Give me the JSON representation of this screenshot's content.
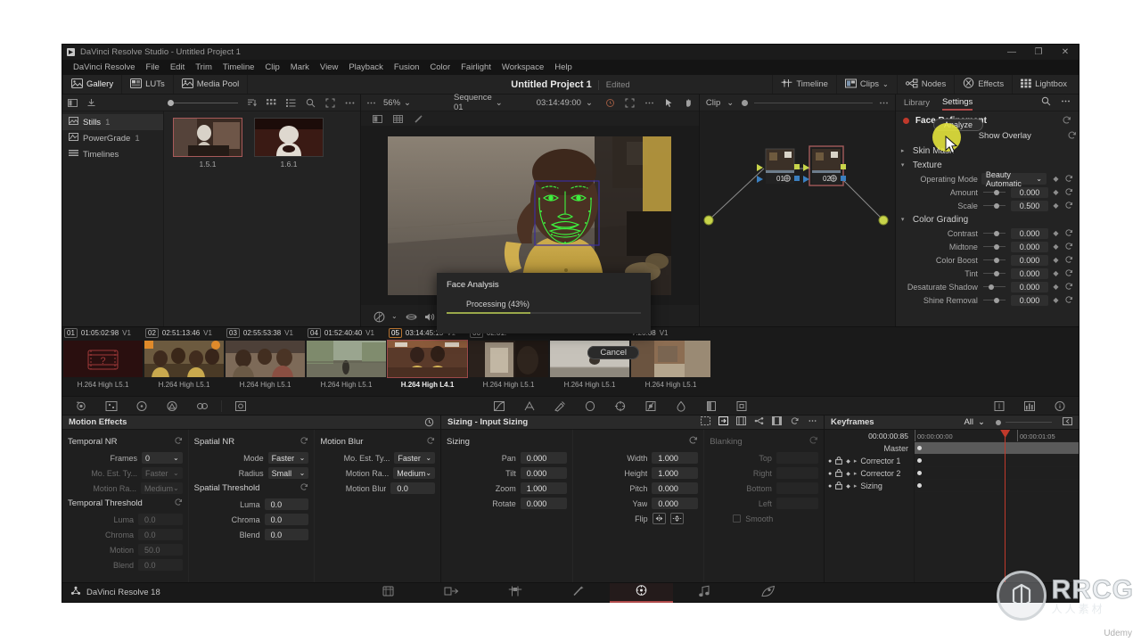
{
  "window": {
    "title": "DaVinci Resolve Studio - Untitled Project 1",
    "minimize": "—",
    "maximize": "❐",
    "close": "✕"
  },
  "menu": [
    "DaVinci Resolve",
    "File",
    "Edit",
    "Trim",
    "Timeline",
    "Clip",
    "Mark",
    "View",
    "Playback",
    "Fusion",
    "Color",
    "Fairlight",
    "Workspace",
    "Help"
  ],
  "toptools": {
    "left_buttons": [
      {
        "label": "Gallery",
        "icon": "gallery-icon"
      },
      {
        "label": "LUTs",
        "icon": "luts-icon"
      },
      {
        "label": "Media Pool",
        "icon": "media-pool-icon"
      }
    ],
    "project_name": "Untitled Project 1",
    "project_state": "Edited",
    "right_buttons": [
      {
        "label": "Timeline",
        "icon": "timeline-icon"
      },
      {
        "label": "Clips",
        "icon": "clips-icon",
        "caret": "⌄"
      },
      {
        "label": "Nodes",
        "icon": "nodes-icon"
      },
      {
        "label": "Effects",
        "icon": "effects-icon"
      },
      {
        "label": "Lightbox",
        "icon": "lightbox-icon"
      }
    ]
  },
  "gallery": {
    "toolbar_icons": [
      "sidebar-toggle-icon",
      "import-still-icon",
      "sort-icon",
      "grid-view-icon",
      "list-view-icon",
      "search-icon",
      "fullscreen-icon",
      "more-options-icon"
    ],
    "tree": [
      {
        "label": "Stills",
        "count": "1",
        "icon": "stills-icon",
        "selected": true
      },
      {
        "label": "PowerGrade",
        "count": "1",
        "icon": "powergrade-icon",
        "selected": false
      },
      {
        "label": "Timelines",
        "count": "",
        "icon": "timelines-icon",
        "selected": false
      }
    ],
    "stills": [
      {
        "caption": "1.5.1",
        "selected": true
      },
      {
        "caption": "1.6.1",
        "selected": false
      }
    ]
  },
  "viewer": {
    "more_icon": "more-options-icon",
    "zoom": "56%",
    "zoom_caret": "⌄",
    "sequence": "Sequence 01",
    "sequence_caret": "⌄",
    "timecode": "03:14:49:00",
    "timecode_caret": "⌄",
    "icons": [
      "loop-icon",
      "fullscreen-icon",
      "more-options-icon",
      "pointer-tool-icon",
      "hand-tool-icon"
    ],
    "tools2": [
      "split-screen-icon",
      "grid-overlay-icon",
      "magic-mask-icon"
    ],
    "clip_label": "Clip",
    "clip_caret": "⌄",
    "bottom_icons": [
      "color-wheel-icon",
      "onion-skin-icon",
      "audio-icon"
    ]
  },
  "nodes": {
    "items": [
      {
        "id": "01",
        "selected": false
      },
      {
        "id": "02",
        "selected": true
      }
    ]
  },
  "modal": {
    "title": "Face Analysis",
    "status": "Processing  (43%)",
    "progress": 43,
    "cancel": "Cancel"
  },
  "tooltip": {
    "label": "Analyze"
  },
  "inspector": {
    "tabs": [
      {
        "label": "Library",
        "active": false
      },
      {
        "label": "Settings",
        "active": true
      }
    ],
    "tab_icons": [
      "search-icon",
      "more-options-icon"
    ],
    "effect_title": "Face Refinement",
    "reset_icon": "reset-icon",
    "buttons": [
      {
        "label": "Analyze"
      },
      {
        "label": "Show Overlay"
      }
    ],
    "sections": [
      {
        "name": "Skin Mask",
        "expanded": false,
        "rows": []
      },
      {
        "name": "Texture",
        "expanded": true,
        "rows": [
          {
            "type": "select",
            "label": "Operating Mode",
            "value": "Beauty Automatic"
          },
          {
            "type": "slider",
            "label": "Amount",
            "value": "0.000",
            "pos": 50
          },
          {
            "type": "slider",
            "label": "Scale",
            "value": "0.500",
            "pos": 50
          }
        ]
      },
      {
        "name": "Color Grading",
        "expanded": true,
        "rows": [
          {
            "type": "slider",
            "label": "Contrast",
            "value": "0.000",
            "pos": 50
          },
          {
            "type": "slider",
            "label": "Midtone",
            "value": "0.000",
            "pos": 50
          },
          {
            "type": "slider",
            "label": "Color Boost",
            "value": "0.000",
            "pos": 50
          },
          {
            "type": "slider",
            "label": "Tint",
            "value": "0.000",
            "pos": 50
          },
          {
            "type": "slider",
            "label": "Desaturate Shadow",
            "value": "0.000",
            "pos": 28
          },
          {
            "type": "slider",
            "label": "Shine Removal",
            "value": "0.000",
            "pos": 50
          }
        ]
      }
    ]
  },
  "timeline_clips": [
    {
      "num": "01",
      "tc": "01:05:02:98",
      "track": "V1",
      "codec": "H.264 High L5.1",
      "selected": false,
      "missing": true
    },
    {
      "num": "02",
      "tc": "02:51:13:46",
      "track": "V1",
      "codec": "H.264 High L5.1",
      "selected": false
    },
    {
      "num": "03",
      "tc": "02:55:53:38",
      "track": "V1",
      "codec": "H.264 High L5.1",
      "selected": false
    },
    {
      "num": "04",
      "tc": "01:52:40:40",
      "track": "V1",
      "codec": "H.264 High L5.1",
      "selected": false
    },
    {
      "num": "05",
      "tc": "03:14:45:15",
      "track": "V1",
      "codec": "H.264 High L4.1",
      "selected": true
    },
    {
      "num": "06",
      "tc": "02:01:",
      "track": "",
      "codec": "H.264 High L5.1",
      "selected": false
    },
    {
      "num": "",
      "tc": "",
      "track": "",
      "codec": "H.264 High L5.1",
      "selected": false
    },
    {
      "num": "",
      "tc": "7:20:08",
      "track": "V1",
      "codec": "H.264 High L5.1",
      "selected": false
    }
  ],
  "fxbar_icons": [
    "camera-raw-icon",
    "color-match-icon",
    "color-wheels-icon",
    "primaries-bars-icon",
    "log-wheels-icon",
    "sep",
    "rgb-mixer-icon",
    "sep2",
    "curves-icon",
    "color-warper-icon",
    "qualifier-icon",
    "power-window-icon",
    "tracker-icon",
    "magic-mask-icon",
    "blur-icon",
    "key-icon",
    "sizing-icon",
    "stabilizer-icon",
    "3d-keyer-icon",
    "scopes-icon",
    "info-icon"
  ],
  "motion_effects": {
    "title": "Motion Effects",
    "reset_icon": "reset-icon",
    "groups": [
      {
        "name": "Temporal NR",
        "rows": [
          {
            "type": "select",
            "label": "Frames",
            "value": "0",
            "dim": false,
            "small": true
          },
          {
            "type": "select",
            "label": "Mo. Est. Ty...",
            "value": "Faster",
            "dim": true
          },
          {
            "type": "select",
            "label": "Motion Ra...",
            "value": "Medium",
            "dim": true
          }
        ]
      },
      {
        "name": "Temporal Threshold",
        "rows": [
          {
            "type": "num",
            "label": "Luma",
            "value": "0.0",
            "dim": true
          },
          {
            "type": "num",
            "label": "Chroma",
            "value": "0.0",
            "dim": true
          },
          {
            "type": "num",
            "label": "Motion",
            "value": "50.0",
            "dim": true
          },
          {
            "type": "num",
            "label": "Blend",
            "value": "0.0",
            "dim": true
          }
        ]
      },
      {
        "name": "Spatial NR",
        "rows": [
          {
            "type": "select",
            "label": "Mode",
            "value": "Faster",
            "dim": false
          },
          {
            "type": "select",
            "label": "Radius",
            "value": "Small",
            "dim": false
          }
        ]
      },
      {
        "name": "Spatial Threshold",
        "rows": [
          {
            "type": "num",
            "label": "Luma",
            "value": "0.0",
            "dim": false
          },
          {
            "type": "num",
            "label": "Chroma",
            "value": "0.0",
            "dim": false
          },
          {
            "type": "num",
            "label": "Blend",
            "value": "0.0",
            "dim": false
          }
        ]
      },
      {
        "name": "Motion Blur",
        "rows": [
          {
            "type": "select",
            "label": "Mo. Est. Ty...",
            "value": "Faster",
            "dim": false
          },
          {
            "type": "select",
            "label": "Motion Ra...",
            "value": "Medium",
            "dim": false
          },
          {
            "type": "num",
            "label": "Motion Blur",
            "value": "0.0",
            "dim": false
          }
        ]
      }
    ]
  },
  "sizing": {
    "title": "Sizing - Input Sizing",
    "header_icons": [
      "input-sizing-icon",
      "output-sizing-icon",
      "node-sizing-icon",
      "stereo-3d-icon",
      "blanking-icon",
      "reset-icon",
      "more-options-icon"
    ],
    "group_sizing": "Sizing",
    "group_blanking": "Blanking",
    "col1": [
      {
        "label": "Pan",
        "value": "0.000"
      },
      {
        "label": "Tilt",
        "value": "0.000"
      },
      {
        "label": "Zoom",
        "value": "1.000"
      },
      {
        "label": "Rotate",
        "value": "0.000"
      }
    ],
    "col2": [
      {
        "label": "Width",
        "value": "1.000"
      },
      {
        "label": "Height",
        "value": "1.000"
      },
      {
        "label": "Pitch",
        "value": "0.000"
      },
      {
        "label": "Yaw",
        "value": "0.000"
      }
    ],
    "flip_label": "Flip",
    "flip_icons": [
      "flip-horizontal-icon",
      "flip-vertical-icon"
    ],
    "blanking": [
      {
        "label": "Top",
        "value": ""
      },
      {
        "label": "Right",
        "value": ""
      },
      {
        "label": "Bottom",
        "value": ""
      },
      {
        "label": "Left",
        "value": ""
      }
    ],
    "smooth_label": "Smooth"
  },
  "keyframes": {
    "title": "Keyframes",
    "filter": "All",
    "filter_caret": "⌄",
    "current_tc": "00:00:00:85",
    "ruler_start": "00:00:00:00",
    "ruler_end": "00:00:01:05",
    "tracks": [
      {
        "label": "Master",
        "master": true
      },
      {
        "label": "Corrector 1",
        "master": false
      },
      {
        "label": "Corrector 2",
        "master": false
      },
      {
        "label": "Sizing",
        "master": false
      }
    ],
    "playhead_pct": 55
  },
  "statusbar": {
    "app_label": "DaVinci Resolve 18",
    "pages": [
      {
        "name": "media-page",
        "icon": "media-icon",
        "active": false
      },
      {
        "name": "cut-page",
        "icon": "cut-icon",
        "active": false
      },
      {
        "name": "edit-page",
        "icon": "edit-icon",
        "active": false
      },
      {
        "name": "fusion-page",
        "icon": "fusion-icon",
        "active": false
      },
      {
        "name": "color-page",
        "icon": "color-icon",
        "active": true
      },
      {
        "name": "fairlight-page",
        "icon": "fairlight-icon",
        "active": false
      },
      {
        "name": "deliver-page",
        "icon": "deliver-icon",
        "active": false
      }
    ]
  },
  "watermark": {
    "brand": "RRCG",
    "subtitle": "人人素材",
    "source": "Udemy"
  },
  "colors": {
    "accent_red": "#b04a4a",
    "progress_green": "#9aa84a",
    "cursor_yellow": "#e8e83c",
    "face_mesh_green": "#3ef03e"
  }
}
